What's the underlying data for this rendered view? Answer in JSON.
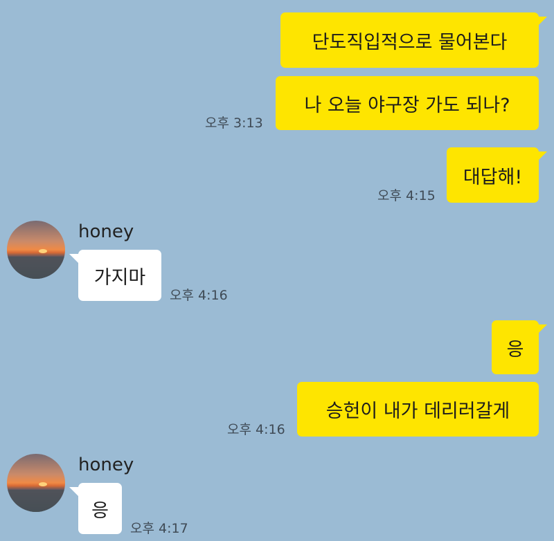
{
  "chat": {
    "messages": [
      {
        "sender": "me",
        "text": "단도직입적으로 물어본다",
        "time": ""
      },
      {
        "sender": "me",
        "text": "나 오늘 야구장 가도 되나?",
        "time": "오후 3:13"
      },
      {
        "sender": "me",
        "text": "대답해!",
        "time": "오후 4:15"
      },
      {
        "sender": "honey",
        "sender_name": "honey",
        "text": "가지마",
        "time": "오후 4:16"
      },
      {
        "sender": "me",
        "text": "응",
        "time": ""
      },
      {
        "sender": "me",
        "text": "승헌이 내가 데리러갈게",
        "time": "오후 4:16"
      },
      {
        "sender": "honey",
        "sender_name": "honey",
        "text": "응",
        "time": "오후 4:17"
      }
    ]
  },
  "colors": {
    "background": "#9bbbd4",
    "my_bubble": "#fee500",
    "their_bubble": "#ffffff"
  },
  "icons": {
    "avatar": "sunset-photo-avatar"
  }
}
